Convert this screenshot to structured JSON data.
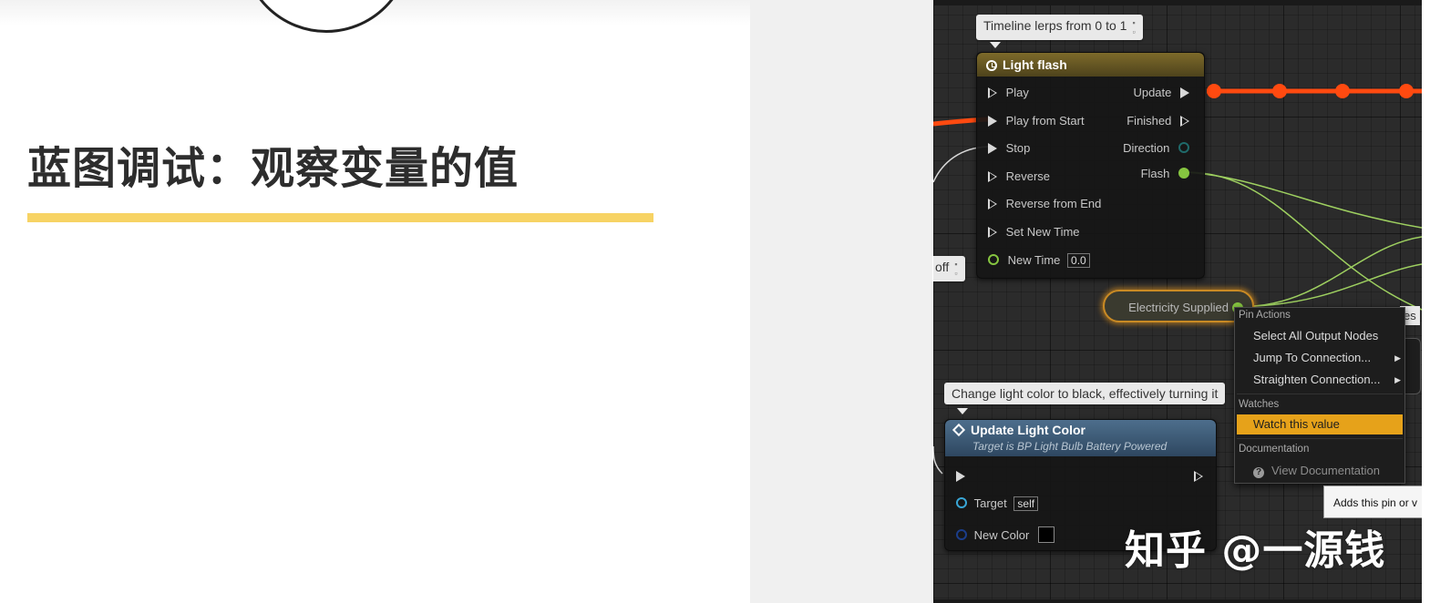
{
  "slide": {
    "title": "蓝图调试：观察变量的值",
    "accent_color": "#f7d364"
  },
  "editor": {
    "comments": {
      "timeline": "Timeline lerps from 0 to 1",
      "off": "off",
      "change_color": "Change light color to black, effectively turning it"
    },
    "timeline_node": {
      "title": "Light flash",
      "icon": "clock-icon",
      "inputs": [
        "Play",
        "Play from Start",
        "Stop",
        "Reverse",
        "Reverse from End",
        "Set New Time",
        "New Time"
      ],
      "new_time_value": "0.0",
      "outputs": [
        "Update",
        "Finished",
        "Direction",
        "Flash"
      ]
    },
    "variable_node": {
      "label": "Electricity Supplied"
    },
    "function_node": {
      "title": "Update Light Color",
      "subtitle": "Target is BP Light Bulb Battery Powered",
      "target_label": "Target",
      "target_value": "self",
      "color_label": "New Color",
      "color_value": "#000000"
    },
    "context_menu": {
      "pin_actions_header": "Pin Actions",
      "select_all": "Select All Output Nodes",
      "jump_to": "Jump To Connection...",
      "straighten": "Straighten Connection...",
      "watches_header": "Watches",
      "watch_value": "Watch this value",
      "documentation_header": "Documentation",
      "view_doc": "View Documentation",
      "submenu_arrow": "▶"
    },
    "tooltip": "Adds this pin or v",
    "partial_label": "es",
    "wire_colors": {
      "exec_active": "#ff4a10",
      "bool": "#9ed060",
      "exec": "#d8d8d8"
    }
  },
  "watermark": "知乎 @一源钱"
}
